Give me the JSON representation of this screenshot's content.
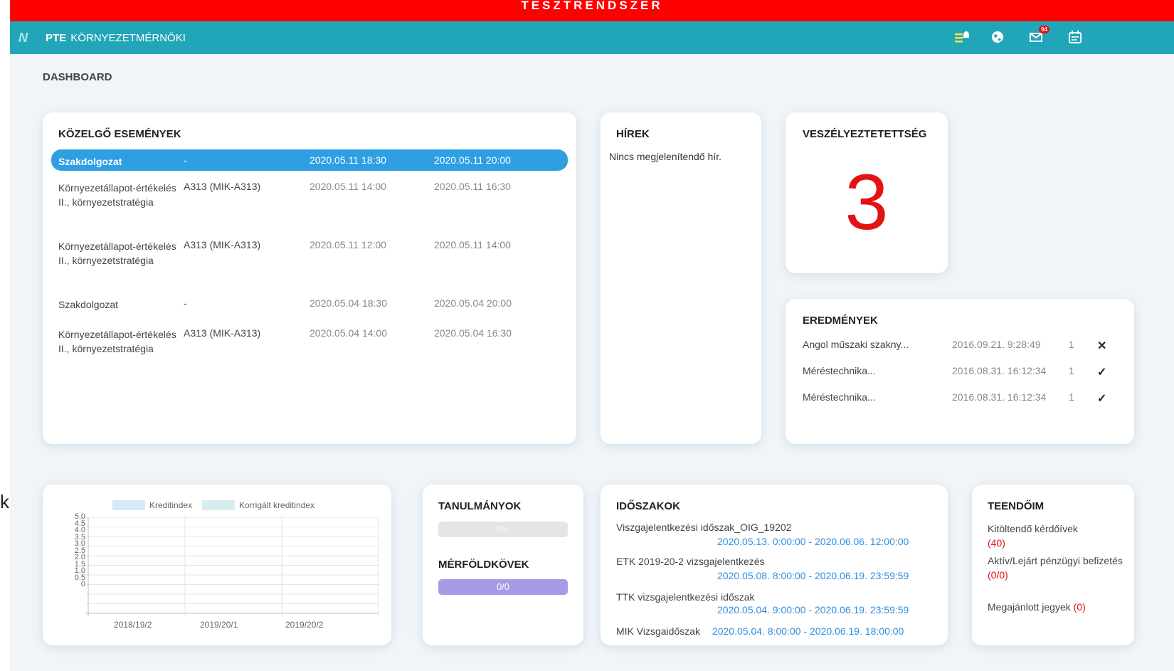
{
  "banner": {
    "text": "TESZTRENDSZER"
  },
  "header": {
    "app_abbr": "PTE",
    "app_name": "KÖRNYEZETMÉRNÖKI",
    "message_badge": "94"
  },
  "left_edge_text": "k",
  "breadcrumb": "DASHBOARD",
  "events": {
    "title": "KÖZELGŐ ESEMÉNYEK",
    "rows": [
      {
        "name": "Szakdolgozat",
        "room": "-",
        "start": "2020.05.11 18:30",
        "end": "2020.05.11 20:00"
      },
      {
        "name": "Környezetállapot-értékelés II., környezetstratégia",
        "room": "A313 (MIK-A313)",
        "start": "2020.05.11 14:00",
        "end": "2020.05.11 16:30"
      },
      {
        "name": "Környezetállapot-értékelés II., környezetstratégia",
        "room": "A313 (MIK-A313)",
        "start": "2020.05.11 12:00",
        "end": "2020.05.11 14:00"
      },
      {
        "name": "Szakdolgozat",
        "room": "-",
        "start": "2020.05.04 18:30",
        "end": "2020.05.04 20:00"
      },
      {
        "name": "Környezetállapot-értékelés II., környezetstratégia",
        "room": "A313 (MIK-A313)",
        "start": "2020.05.04 14:00",
        "end": "2020.05.04 16:30"
      }
    ]
  },
  "news": {
    "title": "HÍREK",
    "empty_text": "Nincs megjelenítendő hír."
  },
  "risk": {
    "title": "VESZÉLYEZTETETTSÉG",
    "value": "3"
  },
  "results": {
    "title": "EREDMÉNYEK",
    "rows": [
      {
        "name": "Angol műszaki szakny...",
        "date": "2016.09.21. 9:28:49",
        "count": "1",
        "status": "failed"
      },
      {
        "name": "Méréstechnika...",
        "date": "2016.08.31. 16:12:34",
        "count": "1",
        "status": "passed"
      },
      {
        "name": "Méréstechnika...",
        "date": "2016.08.31. 16:12:34",
        "count": "1",
        "status": "passed"
      }
    ]
  },
  "chart_data": {
    "type": "bar",
    "categories": [
      "2018/19/2",
      "2019/20/1",
      "2019/20/2"
    ],
    "series": [
      {
        "name": "Kreditindex",
        "values": [
          0,
          0,
          0
        ],
        "color": "#d6eaf8"
      },
      {
        "name": "Korrigált kreditindex",
        "values": [
          0,
          0,
          0
        ],
        "color": "#d5eff0"
      }
    ],
    "y_ticks": [
      "5.0",
      "4.5",
      "4.0",
      "3.5",
      "3.0",
      "2.5",
      "2.0",
      "1.5",
      "1.0",
      "0.5",
      "0"
    ],
    "ylim": [
      0,
      5
    ],
    "grid": true,
    "legend": "top"
  },
  "studies": {
    "title": "TANULMÁNYOK",
    "progress_label": "0%",
    "progress": 0
  },
  "milestones": {
    "title": "MÉRFÖLDKÖVEK",
    "progress_label": "0/0"
  },
  "periods": {
    "title": "IDŐSZAKOK",
    "rows": [
      {
        "name": "Viszgajelentkezési időszak_OIG_19202",
        "range": "2020.05.13. 0:00:00 - 2020.06.06. 12:00:00"
      },
      {
        "name": "ETK 2019-20-2 vizsgajelentkezés",
        "range": "2020.05.08. 8:00:00 - 2020.06.19. 23:59:59"
      },
      {
        "name": "TTK vizsgajelentkezési időszak",
        "range": "2020.05.04. 9:00:00 - 2020.06.19. 23:59:59"
      },
      {
        "name": "MIK Vizsgaidőszak",
        "range": "2020.05.04. 8:00:00 - 2020.06.19. 18:00:00"
      }
    ]
  },
  "todos": {
    "title": "TEENDŐIM",
    "survey_label": "Kitöltendő kérdőívek",
    "survey_count": "(40)",
    "payment_label": "Aktív/Lejárt pénzügyi befizetés",
    "payment_count": "(0/0)",
    "grades_label": "Megajánlott jegyek",
    "grades_count": "(0)"
  },
  "colors": {
    "banner": "#ff0000",
    "topbar": "#21a6b9",
    "active_row": "#2f9fe4",
    "risk": "#e41313",
    "link": "#2f8fe0"
  }
}
